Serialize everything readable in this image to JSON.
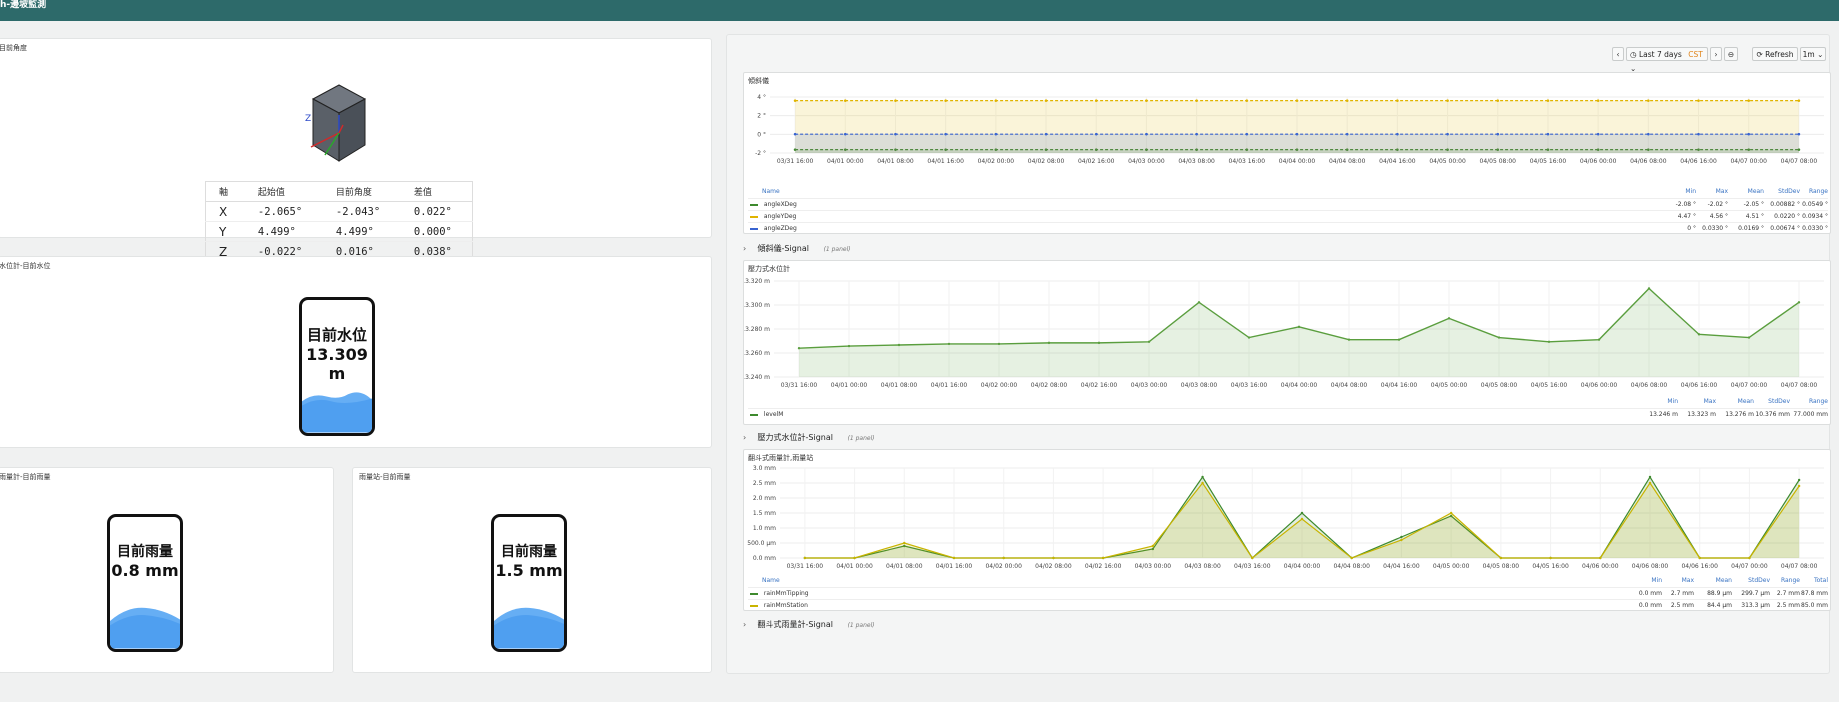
{
  "header": {
    "title": "h-邊坡監測"
  },
  "angle_panel": {
    "title": "目前角度",
    "columns": [
      "軸",
      "起始值",
      "目前角度",
      "差值"
    ],
    "rows": [
      [
        "X",
        "-2.065°",
        "-2.043°",
        "0.022°"
      ],
      [
        "Y",
        "4.499°",
        "4.499°",
        "0.000°"
      ],
      [
        "Z",
        "-0.022°",
        "0.016°",
        "0.038°"
      ]
    ],
    "cube_axis_label": "Z"
  },
  "water_panel": {
    "title": "水位計-目前水位",
    "label": "目前水位",
    "value": "13.309 m",
    "fill_fraction": 0.32
  },
  "rain1_panel": {
    "title": "雨量計-目前雨量",
    "label": "目前雨量",
    "value": "0.8 mm",
    "fill_fraction": 0.33
  },
  "rain2_panel": {
    "title": "雨量站-目前雨量",
    "label": "目前雨量",
    "value": "1.5 mm",
    "fill_fraction": 0.33
  },
  "toolbar": {
    "prev": "‹",
    "time_range": "Last 7 days",
    "timezone": "CST",
    "next": "›",
    "zoom": "⊖",
    "refresh": "Refresh",
    "interval": "1m"
  },
  "tilt_panel": {
    "title": "傾斜儀",
    "legend_headers": [
      "Name",
      "Min",
      "Max",
      "Mean",
      "StdDev",
      "Range"
    ],
    "legend_rows": [
      {
        "name": "angleXDeg",
        "color": "#3e8a2e",
        "stats": [
          "-2.08 °",
          "-2.02 °",
          "-2.05 °",
          "0.00882 °",
          "0.0549 °"
        ]
      },
      {
        "name": "angleYDeg",
        "color": "#e0b400",
        "stats": [
          "4.47 °",
          "4.56 °",
          "4.51 °",
          "0.0220 °",
          "0.0934 °"
        ]
      },
      {
        "name": "angleZDeg",
        "color": "#3863d0",
        "stats": [
          "0 °",
          "0.0330 °",
          "0.0169 °",
          "0.00674 °",
          "0.0330 °"
        ]
      }
    ]
  },
  "row1": {
    "title": "傾斜儀-Signal",
    "count": "(1 panel)"
  },
  "level_panel": {
    "title": "壓力式水位計",
    "legend_headers": [
      "Name",
      "Min",
      "Max",
      "Mean",
      "StdDev",
      "Range"
    ],
    "legend_rows": [
      {
        "name": "levelM",
        "color": "#3e8a2e",
        "stats": [
          "13.246 m",
          "13.323 m",
          "13.276 m",
          "10.376 mm",
          "77.000 mm"
        ]
      }
    ]
  },
  "row2": {
    "title": "壓力式水位計-Signal",
    "count": "(1 panel)"
  },
  "rain_chart_panel": {
    "title": "翻斗式雨量計,雨量站",
    "legend_headers": [
      "Name",
      "Min",
      "Max",
      "Mean",
      "StdDev",
      "Range",
      "Total"
    ],
    "legend_rows": [
      {
        "name": "rainMmTipping",
        "color": "#3e8a2e",
        "stats": [
          "0.0 mm",
          "2.7 mm",
          "88.9 µm",
          "299.7 µm",
          "2.7 mm",
          "87.8 mm"
        ]
      },
      {
        "name": "rainMmStation",
        "color": "#c8b400",
        "stats": [
          "0.0 mm",
          "2.5 mm",
          "84.4 µm",
          "313.3 µm",
          "2.5 mm",
          "85.0 mm"
        ]
      }
    ]
  },
  "row3": {
    "title": "翻斗式雨量計-Signal",
    "count": "(1 panel)"
  },
  "chart_data": [
    {
      "type": "line",
      "title": "傾斜儀",
      "x": [
        "03/31 16:00",
        "04/01 00:00",
        "04/01 08:00",
        "04/01 16:00",
        "04/02 00:00",
        "04/02 08:00",
        "04/02 16:00",
        "04/03 00:00",
        "04/03 08:00",
        "04/03 16:00",
        "04/04 00:00",
        "04/04 08:00",
        "04/04 16:00",
        "04/05 00:00",
        "04/05 08:00",
        "04/05 16:00",
        "04/06 00:00",
        "04/06 08:00",
        "04/06 16:00",
        "04/07 00:00",
        "04/07 08:00"
      ],
      "y_ticks": [
        "4 °",
        "2 °",
        "0 °",
        "-2 °"
      ],
      "ylim": [
        -2.5,
        5
      ],
      "series": [
        {
          "name": "angleXDeg",
          "color": "#3e8a2e",
          "values": [
            -2.05,
            -2.05,
            -2.05,
            -2.05,
            -2.05,
            -2.05,
            -2.05,
            -2.05,
            -2.05,
            -2.05,
            -2.05,
            -2.05,
            -2.05,
            -2.05,
            -2.05,
            -2.05,
            -2.05,
            -2.05,
            -2.05,
            -2.05,
            -2.05
          ]
        },
        {
          "name": "angleYDeg",
          "color": "#e0b400",
          "values": [
            4.51,
            4.51,
            4.51,
            4.51,
            4.51,
            4.51,
            4.51,
            4.51,
            4.51,
            4.51,
            4.51,
            4.51,
            4.51,
            4.51,
            4.51,
            4.51,
            4.51,
            4.51,
            4.51,
            4.51,
            4.51
          ]
        },
        {
          "name": "angleZDeg",
          "color": "#3863d0",
          "values": [
            0.02,
            0.02,
            0.02,
            0.02,
            0.02,
            0.02,
            0.02,
            0.02,
            0.02,
            0.02,
            0.02,
            0.02,
            0.02,
            0.02,
            0.02,
            0.02,
            0.02,
            0.02,
            0.02,
            0.02,
            0.02
          ]
        }
      ]
    },
    {
      "type": "line",
      "title": "壓力式水位計",
      "x": [
        "03/31 16:00",
        "04/01 00:00",
        "04/01 08:00",
        "04/01 16:00",
        "04/02 00:00",
        "04/02 08:00",
        "04/02 16:00",
        "04/03 00:00",
        "04/03 08:00",
        "04/03 16:00",
        "04/04 00:00",
        "04/04 08:00",
        "04/04 16:00",
        "04/05 00:00",
        "04/05 08:00",
        "04/05 16:00",
        "04/06 00:00",
        "04/06 08:00",
        "04/06 16:00",
        "04/07 00:00",
        "04/07 08:00"
      ],
      "y_ticks": [
        "13.320 m",
        "13.300 m",
        "13.280 m",
        "13.260 m",
        "13.240 m"
      ],
      "ylim": [
        13.235,
        13.325
      ],
      "series": [
        {
          "name": "levelM",
          "color": "#5a9e3e",
          "values": [
            13.262,
            13.264,
            13.265,
            13.266,
            13.266,
            13.267,
            13.267,
            13.268,
            13.305,
            13.272,
            13.282,
            13.27,
            13.27,
            13.29,
            13.272,
            13.268,
            13.27,
            13.318,
            13.275,
            13.272,
            13.305
          ]
        }
      ]
    },
    {
      "type": "area",
      "title": "翻斗式雨量計,雨量站",
      "x": [
        "03/31 16:00",
        "04/01 00:00",
        "04/01 08:00",
        "04/01 16:00",
        "04/02 00:00",
        "04/02 08:00",
        "04/02 16:00",
        "04/03 00:00",
        "04/03 08:00",
        "04/03 16:00",
        "04/04 00:00",
        "04/04 08:00",
        "04/04 16:00",
        "04/05 00:00",
        "04/05 08:00",
        "04/05 16:00",
        "04/06 00:00",
        "04/06 08:00",
        "04/06 16:00",
        "04/07 00:00",
        "04/07 08:00"
      ],
      "y_ticks": [
        "3.0 mm",
        "2.5 mm",
        "2.0 mm",
        "1.5 mm",
        "1.0 mm",
        "500.0 µm",
        "0.0 mm"
      ],
      "ylim": [
        0,
        3
      ],
      "series": [
        {
          "name": "rainMmTipping",
          "color": "#3e8a2e",
          "values": [
            0,
            0,
            0.4,
            0,
            0,
            0,
            0,
            0.3,
            2.7,
            0,
            1.5,
            0,
            0.7,
            1.4,
            0,
            0,
            0,
            2.7,
            0,
            0,
            2.6
          ]
        },
        {
          "name": "rainMmStation",
          "color": "#c8b400",
          "values": [
            0,
            0,
            0.5,
            0,
            0,
            0,
            0,
            0.4,
            2.5,
            0,
            1.3,
            0,
            0.6,
            1.5,
            0,
            0,
            0,
            2.5,
            0,
            0,
            2.4
          ]
        }
      ]
    }
  ]
}
